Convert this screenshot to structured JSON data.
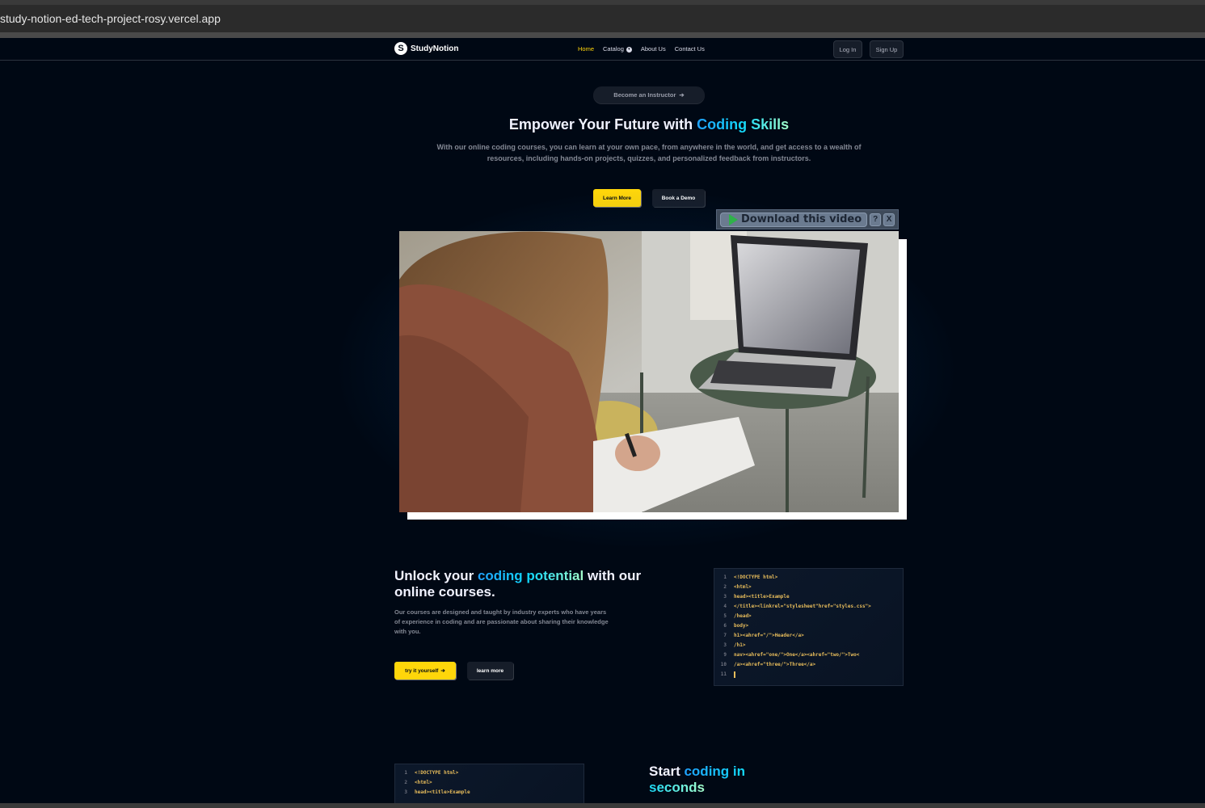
{
  "browser": {
    "url": "study-notion-ed-tech-project-rosy.vercel.app"
  },
  "navbar": {
    "logo_mark": "S",
    "logo_text": "StudyNotion",
    "links": [
      {
        "label": "Home",
        "active": true
      },
      {
        "label": "Catalog",
        "dropdown": true
      },
      {
        "label": "About Us"
      },
      {
        "label": "Contact Us"
      }
    ],
    "login_label": "Log In",
    "signup_label": "Sign Up"
  },
  "hero": {
    "instructor_label": "Become an Instructor",
    "title_prefix": "Empower Your Future with ",
    "title_highlight": "Coding Skills",
    "description": "With our online coding courses, you can learn at your own pace, from anywhere in the world, and get access to a wealth of resources, including hands-on projects, quizzes, and personalized feedback from instructors.",
    "learn_more_label": "Learn More",
    "book_demo_label": "Book a Demo"
  },
  "video_overlay": {
    "download_label": "Download this video",
    "help_label": "?",
    "close_label": "X"
  },
  "section_unlock": {
    "title_1": "Unlock your ",
    "title_highlight": "coding potential",
    "title_2": " with our online courses.",
    "description": "Our courses are designed and taught by industry experts who have years of experience in coding and are passionate about sharing their knowledge with you.",
    "primary_label": "try it yourself",
    "secondary_label": "learn more",
    "code_lines": [
      "<!DOCTYPE html>",
      "<html>",
      "head><title>Example",
      "</title><linkrel=\"stylesheet\"href=\"styles.css\">",
      "/head>",
      "body>",
      "h1><ahref=\"/\">Header</a>",
      "/h1>",
      "nav><ahref=\"one/\">One</a><ahref=\"two/\">Two<",
      "/a><ahref=\"three/\">Three</a>",
      ""
    ]
  },
  "section_start": {
    "title_1": "Start ",
    "title_highlight": "coding in seconds",
    "code_lines": [
      "<!DOCTYPE html>",
      "<html>",
      "head><title>Example"
    ]
  },
  "colors": {
    "accent_yellow": "#FFD60A",
    "highlight_blue": "#12D8FA",
    "background": "#000814"
  }
}
